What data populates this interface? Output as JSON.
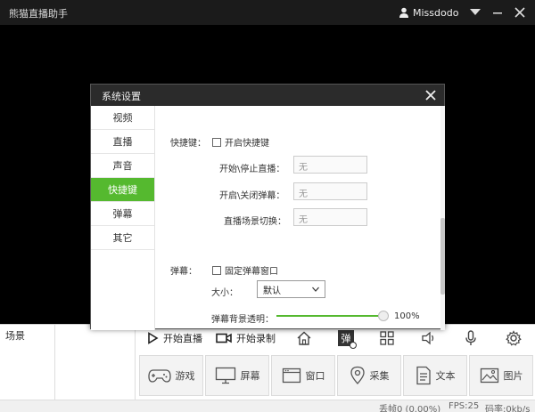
{
  "titlebar": {
    "app_title": "熊猫直播助手",
    "username": "Missdodo"
  },
  "scene": {
    "label": "场景"
  },
  "toolbar": {
    "start_live": "开始直播",
    "start_record": "开始录制",
    "danmaku_icon_text": "弹"
  },
  "sources": [
    {
      "label": "游戏",
      "icon": "gamepad-icon"
    },
    {
      "label": "屏幕",
      "icon": "monitor-icon"
    },
    {
      "label": "窗口",
      "icon": "window-icon"
    },
    {
      "label": "采集",
      "icon": "location-icon"
    },
    {
      "label": "文本",
      "icon": "text-icon"
    },
    {
      "label": "图片",
      "icon": "image-icon"
    }
  ],
  "status": {
    "dropped": "丢帧0 (0.00%)",
    "fps": "FPS:25",
    "bitrate": "码率:0kb/s"
  },
  "dialog": {
    "title": "系统设置",
    "nav": [
      {
        "label": "视频"
      },
      {
        "label": "直播"
      },
      {
        "label": "声音"
      },
      {
        "label": "快捷键"
      },
      {
        "label": "弹幕"
      },
      {
        "label": "其它"
      }
    ],
    "active_nav": 3,
    "hotkeys": {
      "section_label": "快捷键：",
      "enable_label": "开启快捷键",
      "enabled": false,
      "rows": [
        {
          "label": "开始\\停止直播：",
          "value": "无"
        },
        {
          "label": "开启\\关闭弹幕：",
          "value": "无"
        },
        {
          "label": "直播场景切换：",
          "value": "无"
        }
      ]
    },
    "danmaku": {
      "section_label": "弹幕：",
      "fixed_window_label": "固定弹幕窗口",
      "fixed_window": false,
      "size_label": "大小：",
      "size_value": "默认",
      "opacity_label": "弹幕背景透明：",
      "opacity_value": "100%",
      "opacity_fraction": 1.0
    }
  },
  "colors": {
    "accent": "#55b92f",
    "titlebar_bg": "#1b1b1b",
    "dialog_header_bg": "#2b2b2b"
  }
}
